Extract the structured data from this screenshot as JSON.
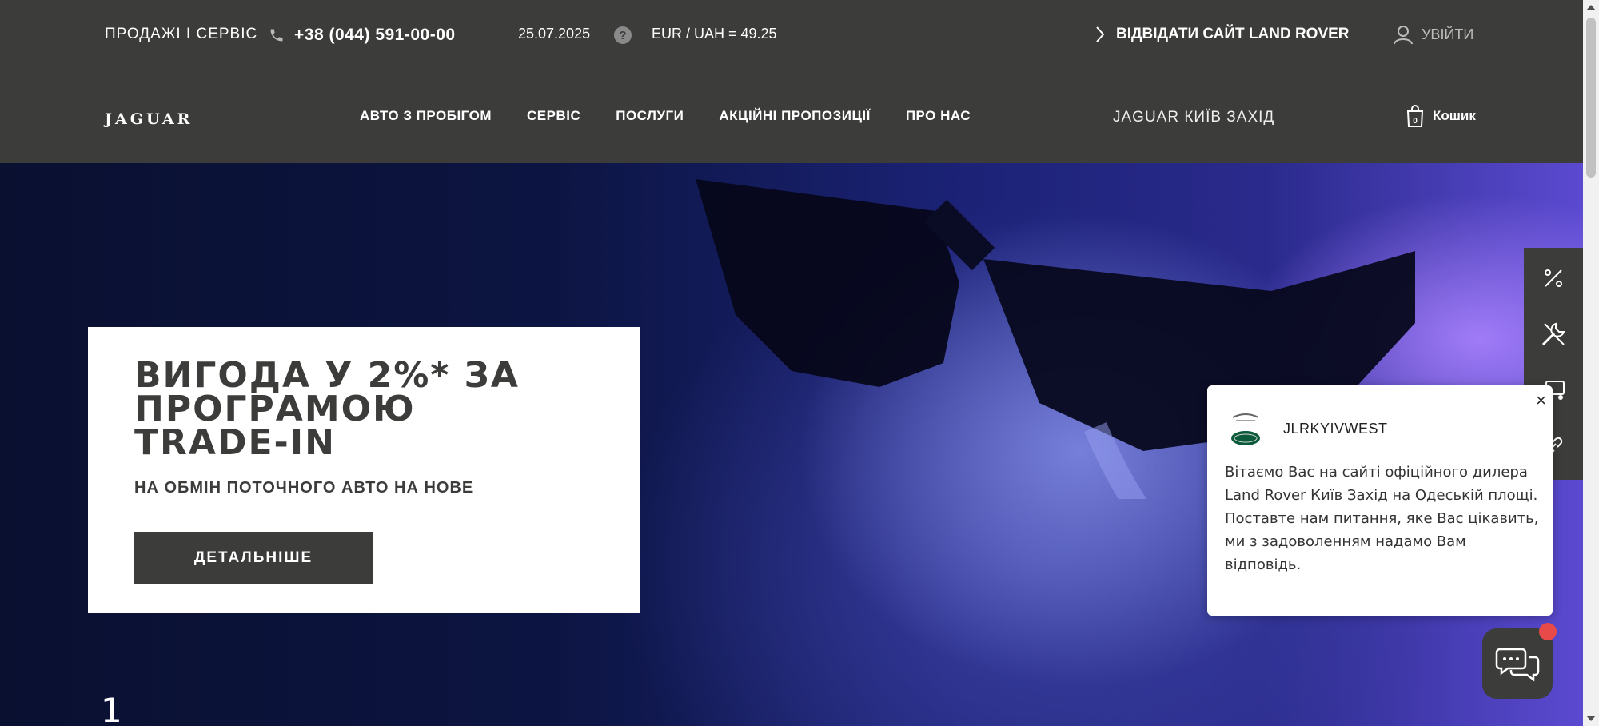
{
  "topbar": {
    "sales_label": "ПРОДАЖІ І СЕРВІС",
    "phone": "+38 (044) 591-00-00",
    "date": "25.07.2025",
    "help_icon": "?",
    "rate": "EUR / UAH = 49.25",
    "visit_label": "ВІДВІДАТИ САЙТ LAND ROVER",
    "login_label": "УВІЙТИ"
  },
  "nav": {
    "logo": "JAGUAR",
    "items": [
      {
        "label": "АВТО З ПРОБІГОМ"
      },
      {
        "label": "СЕРВІС"
      },
      {
        "label": "ПОСЛУГИ"
      },
      {
        "label": "АКЦІЙНІ ПРОПОЗИЦІЇ"
      },
      {
        "label": "ПРО НАС"
      }
    ],
    "dealer": "JAGUAR КИЇВ ЗАХІД",
    "cart_label": "Кошик",
    "cart_count": "0"
  },
  "hero": {
    "title": "ВИГОДА У 2%* ЗА ПРОГРАМОЮ TRADE-IN",
    "subtitle": "НА ОБМІН ПОТОЧНОГО АВТО НА НОВЕ",
    "button": "ДЕТАЛЬНІШЕ",
    "slide_number": "1"
  },
  "side_rail": {
    "icons": [
      "percent-icon",
      "tools-icon",
      "car-icon",
      "link-icon"
    ]
  },
  "chat": {
    "name": "JLRKYIVWEST",
    "message_line1": "Вітаємо Вас на сайті офіційного дилера Land Rover Київ Захід на Одеській площі.",
    "message_line2": "Поставте нам питання, яке Вас цікавить, ми з задоволенням надамо Вам відповідь.",
    "close_icon": "×"
  },
  "colors": {
    "header_bg": "#3c3c3b",
    "notification": "#e84a4a"
  }
}
